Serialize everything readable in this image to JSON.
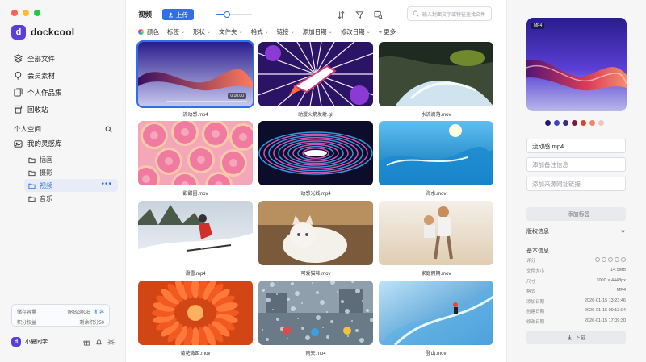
{
  "app": {
    "name": "dockcool",
    "logo_letter": "d"
  },
  "window_controls": [
    {
      "name": "close",
      "color": "#ff5f57"
    },
    {
      "name": "minimize",
      "color": "#febc2e"
    },
    {
      "name": "maximize",
      "color": "#28c840"
    }
  ],
  "sidebar": {
    "nav": [
      {
        "label": "全部文件",
        "icon": "layers-icon"
      },
      {
        "label": "会员素材",
        "icon": "bulb-icon"
      },
      {
        "label": "个人作品集",
        "icon": "portfolio-icon"
      },
      {
        "label": "回收站",
        "icon": "trash-icon"
      }
    ],
    "space_title": "个人空间",
    "library_label": "我的灵感库",
    "folders": [
      {
        "label": "插画",
        "active": false
      },
      {
        "label": "摄影",
        "active": false
      },
      {
        "label": "视频",
        "active": true
      },
      {
        "label": "音乐",
        "active": false
      }
    ],
    "more_label": "•••",
    "storage": {
      "storage_label": "储存容量",
      "storage_value": "0KB/30GB",
      "expand_label": "扩容",
      "points_label": "积分权益",
      "points_value": "剩余积分50"
    },
    "user": {
      "name": "小夏同学",
      "avatar_letter": "d"
    }
  },
  "toolbar": {
    "breadcrumb": "视频",
    "upload_label": "上传",
    "zoom_level": 0.3,
    "search_placeholder": "输入封面文字或特征查找文件"
  },
  "filters": [
    {
      "label": "颜色",
      "chevron": false
    },
    {
      "label": "标签",
      "chevron": true
    },
    {
      "label": "形状",
      "chevron": true
    },
    {
      "label": "文件夹",
      "chevron": true
    },
    {
      "label": "格式",
      "chevron": true
    },
    {
      "label": "链接",
      "chevron": true
    },
    {
      "label": "添加日期",
      "chevron": true
    },
    {
      "label": "修改日期",
      "chevron": true
    },
    {
      "label": "+ 更多",
      "chevron": false
    }
  ],
  "files": [
    {
      "name": "流动感.mp4",
      "selected": true,
      "timecode": "0:10.00"
    },
    {
      "name": "动漫火箭发射.gif",
      "selected": false
    },
    {
      "name": "水流滴落.mov",
      "selected": false
    },
    {
      "name": "甜甜圈.mov",
      "selected": false
    },
    {
      "name": "动感光线.mp4",
      "selected": false
    },
    {
      "name": "海水.mov",
      "selected": false
    },
    {
      "name": "滑雪.mp4",
      "selected": false
    },
    {
      "name": "可爱猫咪.mov",
      "selected": false
    },
    {
      "name": "家庭假期.mov",
      "selected": false
    },
    {
      "name": "菊花微距.mov",
      "selected": false
    },
    {
      "name": "雨天.mp4",
      "selected": false
    },
    {
      "name": "登山.mov",
      "selected": false
    }
  ],
  "details": {
    "format_badge": "MP4",
    "palette": [
      "#1e1a6e",
      "#3c45b8",
      "#3a2a80",
      "#7a1a3a",
      "#d8452d",
      "#f0856e",
      "#f2c3c0"
    ],
    "name_value": "流动感.mp4",
    "note_placeholder": "添加备注信息",
    "link_placeholder": "添加来源网址链接",
    "add_tag_label": "+ 添加标签",
    "copyright_label": "版权信息",
    "basic_info_label": "基本信息",
    "rating_label": "评分",
    "rating_value": 0,
    "info": [
      {
        "key": "文件大小",
        "value": "14.5MB"
      },
      {
        "key": "尺寸",
        "value": "3000 × 4448px"
      },
      {
        "key": "格式",
        "value": "MP4"
      },
      {
        "key": "添加日期",
        "value": "2026-01-15 13:23:46"
      },
      {
        "key": "创建日期",
        "value": "2026-01-15 09:13:04"
      },
      {
        "key": "修改日期",
        "value": "2026-01-15 17:09:30"
      }
    ],
    "download_label": "下载"
  }
}
